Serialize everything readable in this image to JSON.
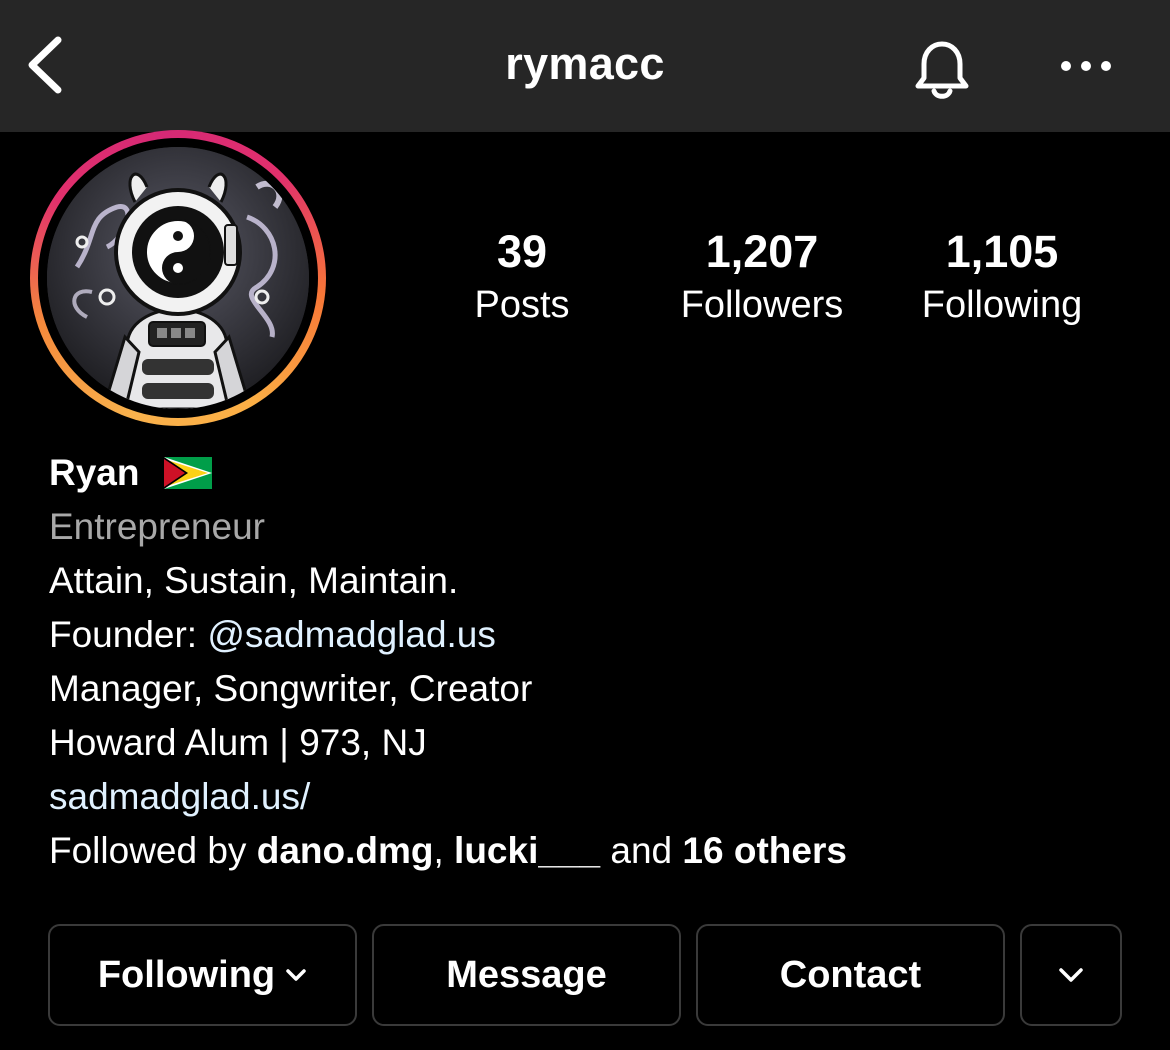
{
  "nav": {
    "back_icon": "chevron-left-icon",
    "username": "rymacc",
    "bell_icon": "bell-icon",
    "more_icon": "more-horizontal-icon"
  },
  "profile": {
    "avatar_icon": "astronaut-avatar",
    "ring_colors": [
      "#fcaf45",
      "#f77737",
      "#e1306c",
      "#d62976"
    ]
  },
  "stats": [
    {
      "value": "39",
      "label": "Posts"
    },
    {
      "value": "1,207",
      "label": "Followers"
    },
    {
      "value": "1,105",
      "label": "Following"
    }
  ],
  "bio": {
    "name": "Ryan",
    "flag": "guyana-flag",
    "category": "Entrepreneur",
    "line1": "Attain, Sustain, Maintain.",
    "founder_prefix": "Founder: ",
    "founder_mention": "@sadmadglad.us",
    "line3": "Manager, Songwriter, Creator",
    "line4": "Howard Alum | 973, NJ",
    "website": "sadmadglad.us/",
    "followed_prefix": "Followed by ",
    "followed_user1": "dano.dmg",
    "followed_sep": ", ",
    "followed_user2": "lucki___",
    "followed_and": " and ",
    "followed_others": "16 others",
    "link_color": "#e0f1ff"
  },
  "actions": {
    "following_label": "Following",
    "message_label": "Message",
    "contact_label": "Contact",
    "more_icon": "chevron-down-icon"
  }
}
